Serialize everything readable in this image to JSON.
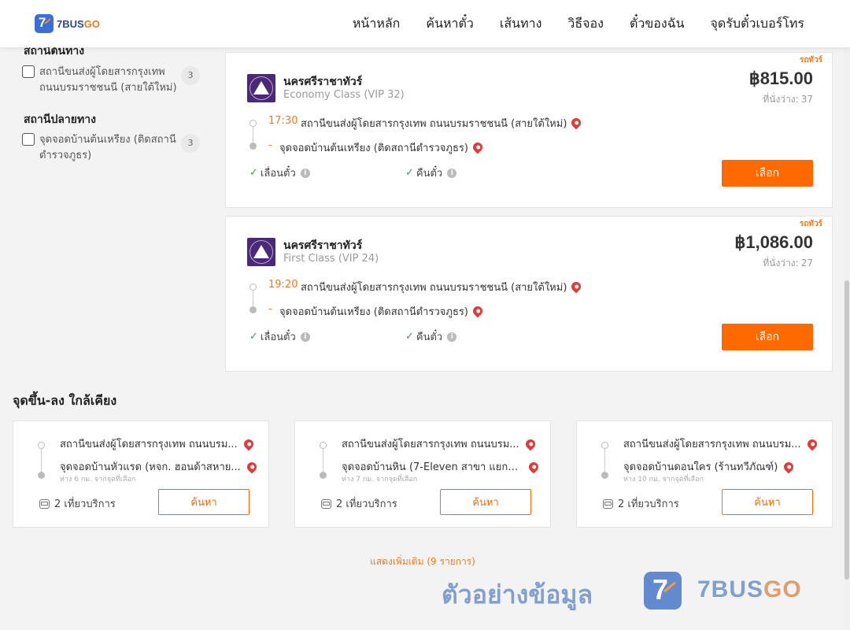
{
  "header": {
    "brand_number": "7",
    "brand_prefix": "7BUS",
    "brand_suffix": "GO",
    "nav": [
      "หน้าหลัก",
      "ค้นหาตั๋ว",
      "เส้นทาง",
      "วิธีจอง",
      "ตั๋วของฉัน",
      "จุดรับตั๋วเบอร์โทร"
    ]
  },
  "sidebar": {
    "origin_title": "สถานีต้นทาง",
    "origin_options": [
      {
        "label": "สถานีขนส่งผู้โดยสารกรุงเทพ ถนนบรมราชชนนี (สายใต้ใหม่)",
        "count": "3"
      }
    ],
    "dest_title": "สถานีปลายทาง",
    "dest_options": [
      {
        "label": "จุดจอดบ้านต้นเหรียง (ติดสถานีตำรวจภูธร)",
        "count": "3"
      }
    ]
  },
  "trips": [
    {
      "ribbon": "รถทัวร์",
      "operator": "นครศรีราชาทัวร์",
      "class": "Economy Class (VIP 32)",
      "price": "฿815.00",
      "seats_label": "ที่นั่งว่าง:",
      "seats": "37",
      "dep_time": "17:30",
      "dep_station": "สถานีขนส่งผู้โดยสารกรุงเทพ ถนนบรมราชชนนี (สายใต้ใหม่)",
      "arr_time": "-",
      "arr_station": "จุดจอดบ้านต้นเหรียง (ติดสถานีตำรวจภูธร)",
      "feature1": "เลื่อนตั๋ว",
      "feature2": "คืนตั๋ว",
      "button": "เลือก"
    },
    {
      "ribbon": "รถทัวร์",
      "operator": "นครศรีราชาทัวร์",
      "class": "First Class (VIP 24)",
      "price": "฿1,086.00",
      "seats_label": "ที่นั่งว่าง:",
      "seats": "27",
      "dep_time": "19:20",
      "dep_station": "สถานีขนส่งผู้โดยสารกรุงเทพ ถนนบรมราชชนนี (สายใต้ใหม่)",
      "arr_time": "-",
      "arr_station": "จุดจอดบ้านต้นเหรียง (ติดสถานีตำรวจภูธร)",
      "feature1": "เลื่อนตั๋ว",
      "feature2": "คืนตั๋ว",
      "button": "เลือก"
    }
  ],
  "nearby": {
    "title": "จุดขึ้น-ลง ใกล้เคียง",
    "cards": [
      {
        "from": "สถานีขนส่งผู้โดยสารกรุงเทพ ถนนบรม...",
        "to": "จุดจอดบ้านหัวแรด (หจก. ฮอนด้าสหาย...",
        "distance": "ห่าง 6 กม. จากจุดที่เลือก",
        "trips": "2 เที่ยวบริการ",
        "button": "ค้นหา"
      },
      {
        "from": "สถานีขนส่งผู้โดยสารกรุงเทพ ถนนบรม...",
        "to": "จุดจอดบ้านหิน (7-Eleven สาขา แยกบ้...",
        "distance": "ห่าง 7 กม. จากจุดที่เลือก",
        "trips": "2 เที่ยวบริการ",
        "button": "ค้นหา"
      },
      {
        "from": "สถานีขนส่งผู้โดยสารกรุงเทพ ถนนบรม...",
        "to": "จุดจอดบ้านดอนใคร (ร้านทวีภัณฑ์)",
        "distance": "ห่าง 10 กม. จากจุดที่เลือก",
        "trips": "2 เที่ยวบริการ",
        "button": "ค้นหา"
      }
    ]
  },
  "show_more": "แสดงเพิ่มเติม (9 รายการ)",
  "watermark": {
    "text": "ตัวอย่างข้อมูล",
    "badge_number": "7",
    "brand_prefix": "7BUS",
    "brand_suffix": "GO"
  },
  "colors": {
    "accent": "#ff6a00",
    "brand_blue": "#3b6fd6",
    "operator_logo": "#4b2878",
    "check_green": "#43a047",
    "pin_red": "#e53935"
  },
  "icons": {
    "logo": "7busgo-logo-icon",
    "operator": "temple-logo-icon",
    "location": "map-pin-icon",
    "check": "check-icon",
    "info": "info-icon",
    "bus": "bus-icon"
  }
}
